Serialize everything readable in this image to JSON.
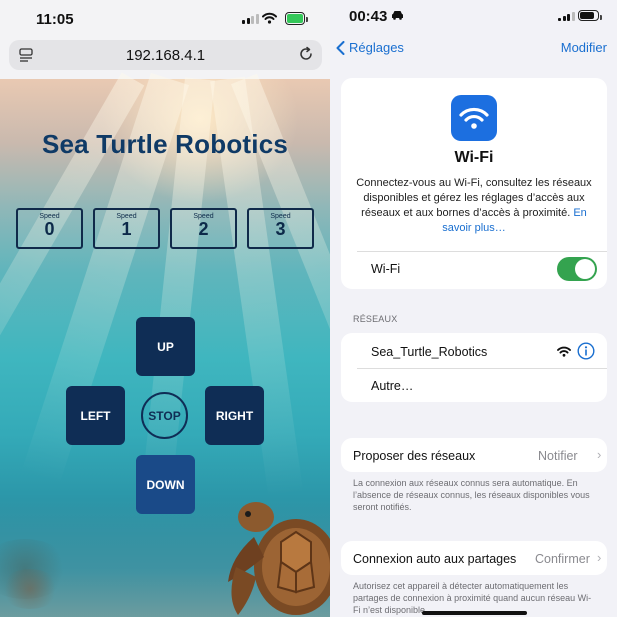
{
  "left_phone": {
    "status": {
      "time": "11:05"
    },
    "browser": {
      "url": "192.168.4.1"
    },
    "app": {
      "title": "Sea Turtle Robotics",
      "speed_label": "Speed",
      "speeds": [
        "0",
        "1",
        "2",
        "3"
      ],
      "controls": {
        "up": "UP",
        "left": "LEFT",
        "stop": "STOP",
        "right": "RIGHT",
        "down": "DOWN"
      }
    }
  },
  "right_phone": {
    "status": {
      "time": "00:43"
    },
    "nav": {
      "back_label": "Réglages",
      "edit_label": "Modifier"
    },
    "wifi_card": {
      "title": "Wi-Fi",
      "description": "Connectez-vous au Wi-Fi, consultez les réseaux disponibles et gérez les réglages d’accès aux réseaux et aux bornes d’accès à proximité.",
      "learn_more": "En savoir plus…",
      "toggle_label": "Wi-Fi",
      "toggle_on": true
    },
    "networks": {
      "section_title": "RÉSEAUX",
      "items": [
        {
          "name": "Sea_Turtle_Robotics"
        },
        {
          "name": "Autre…"
        }
      ]
    },
    "ask_join": {
      "label": "Proposer des réseaux",
      "value": "Notifier",
      "note": "La connexion aux réseaux connus sera automatique. En l’absence de réseaux connus, les réseaux disponibles vous seront notifiés."
    },
    "auto_hotspot": {
      "label": "Connexion auto aux partages",
      "value": "Confirmer",
      "note": "Autorisez cet appareil à détecter automatiquement les partages de connexion à proximité quand aucun réseau Wi-Fi n’est disponible."
    }
  },
  "colors": {
    "title_navy": "#0f3a66",
    "button_navy": "#0f2d55",
    "ios_blue": "#1a6fd0",
    "toggle_green": "#34a34f",
    "battery_green": "#34c759"
  }
}
